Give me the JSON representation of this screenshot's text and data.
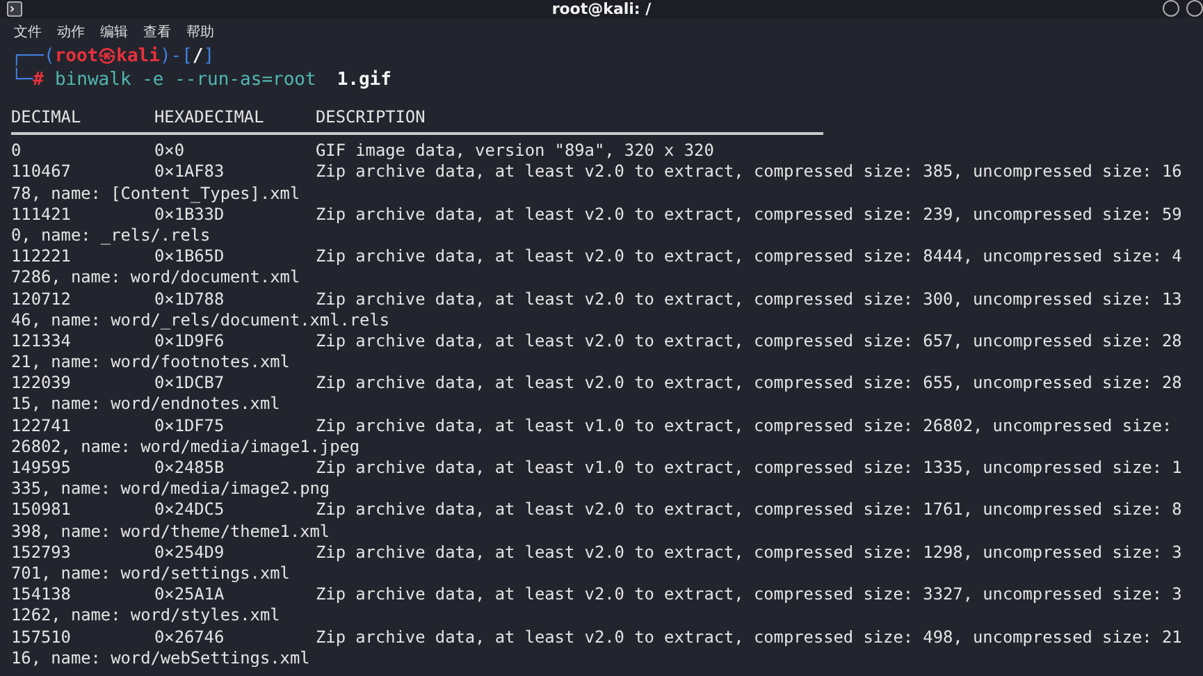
{
  "window": {
    "title": "root@kali: /"
  },
  "menu": [
    "文件",
    "动作",
    "编辑",
    "查看",
    "帮助"
  ],
  "prompt": {
    "line1": [
      {
        "text": "┌──(",
        "kind": "frame"
      },
      {
        "text": "root㉿kali",
        "kind": "user"
      },
      {
        "text": ")-[",
        "kind": "frame"
      },
      {
        "text": "/",
        "kind": "path"
      },
      {
        "text": "]",
        "kind": "frame"
      }
    ],
    "line2": [
      {
        "text": "└─",
        "kind": "frame"
      },
      {
        "text": "#",
        "kind": "user"
      },
      {
        "text": "binwalk -e --run-as=root",
        "kind": "command"
      },
      {
        "text": "1.gif",
        "kind": "argument"
      }
    ]
  },
  "table": {
    "columns": [
      "DECIMAL",
      "HEXADECIMAL",
      "DESCRIPTION"
    ],
    "rows": [
      {
        "decimal": "0",
        "hexadecimal": "0×0",
        "description": "GIF image data, version \"89a\", 320 x 320"
      },
      {
        "decimal": "110467",
        "hexadecimal": "0×1AF83",
        "description": "Zip archive data, at least v2.0 to extract, compressed size: 385, uncompressed size: 16",
        "continuation": "78, name: [Content_Types].xml"
      },
      {
        "decimal": "111421",
        "hexadecimal": "0×1B33D",
        "description": "Zip archive data, at least v2.0 to extract, compressed size: 239, uncompressed size: 59",
        "continuation": "0, name: _rels/.rels"
      },
      {
        "decimal": "112221",
        "hexadecimal": "0×1B65D",
        "description": "Zip archive data, at least v2.0 to extract, compressed size: 8444, uncompressed size: 4",
        "continuation": "7286, name: word/document.xml"
      },
      {
        "decimal": "120712",
        "hexadecimal": "0×1D788",
        "description": "Zip archive data, at least v2.0 to extract, compressed size: 300, uncompressed size: 13",
        "continuation": "46, name: word/_rels/document.xml.rels"
      },
      {
        "decimal": "121334",
        "hexadecimal": "0×1D9F6",
        "description": "Zip archive data, at least v2.0 to extract, compressed size: 657, uncompressed size: 28",
        "continuation": "21, name: word/footnotes.xml"
      },
      {
        "decimal": "122039",
        "hexadecimal": "0×1DCB7",
        "description": "Zip archive data, at least v2.0 to extract, compressed size: 655, uncompressed size: 28",
        "continuation": "15, name: word/endnotes.xml"
      },
      {
        "decimal": "122741",
        "hexadecimal": "0×1DF75",
        "description": "Zip archive data, at least v1.0 to extract, compressed size: 26802, uncompressed size:",
        "continuation": "26802, name: word/media/image1.jpeg"
      },
      {
        "decimal": "149595",
        "hexadecimal": "0×2485B",
        "description": "Zip archive data, at least v1.0 to extract, compressed size: 1335, uncompressed size: 1",
        "continuation": "335, name: word/media/image2.png"
      },
      {
        "decimal": "150981",
        "hexadecimal": "0×24DC5",
        "description": "Zip archive data, at least v2.0 to extract, compressed size: 1761, uncompressed size: 8",
        "continuation": "398, name: word/theme/theme1.xml"
      },
      {
        "decimal": "152793",
        "hexadecimal": "0×254D9",
        "description": "Zip archive data, at least v2.0 to extract, compressed size: 1298, uncompressed size: 3",
        "continuation": "701, name: word/settings.xml"
      },
      {
        "decimal": "154138",
        "hexadecimal": "0×25A1A",
        "description": "Zip archive data, at least v2.0 to extract, compressed size: 3327, uncompressed size: 3",
        "continuation": "1262, name: word/styles.xml"
      },
      {
        "decimal": "157510",
        "hexadecimal": "0×26746",
        "description": "Zip archive data, at least v2.0 to extract, compressed size: 498, uncompressed size: 21",
        "continuation": "16, name: word/webSettings.xml"
      }
    ]
  }
}
